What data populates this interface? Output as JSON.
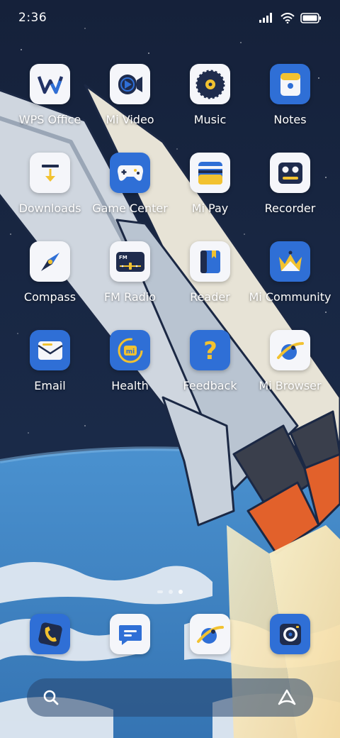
{
  "status": {
    "time": "2:36",
    "icons": [
      "signal-icon",
      "wifi-icon",
      "battery-icon"
    ]
  },
  "apps": [
    {
      "label": "WPS Office",
      "icon": "wps-office-icon"
    },
    {
      "label": "Mi Video",
      "icon": "mi-video-icon"
    },
    {
      "label": "Music",
      "icon": "music-icon"
    },
    {
      "label": "Notes",
      "icon": "notes-icon"
    },
    {
      "label": "Downloads",
      "icon": "downloads-icon"
    },
    {
      "label": "Game Center",
      "icon": "game-center-icon"
    },
    {
      "label": "Mi Pay",
      "icon": "mi-pay-icon"
    },
    {
      "label": "Recorder",
      "icon": "recorder-icon"
    },
    {
      "label": "Compass",
      "icon": "compass-icon"
    },
    {
      "label": "FM Radio",
      "icon": "fm-radio-icon"
    },
    {
      "label": "Reader",
      "icon": "reader-icon"
    },
    {
      "label": "Mi Community",
      "icon": "mi-community-icon"
    },
    {
      "label": "Email",
      "icon": "email-icon"
    },
    {
      "label": "Health",
      "icon": "health-icon"
    },
    {
      "label": "Feedback",
      "icon": "feedback-icon"
    },
    {
      "label": "Mi Browser",
      "icon": "mi-browser-icon"
    }
  ],
  "icon_text": {
    "fm": "FM",
    "health": "mi",
    "feedback": "?"
  },
  "pages": {
    "count": 3,
    "current": 2
  },
  "dock": [
    {
      "icon": "phone-icon"
    },
    {
      "icon": "messages-icon"
    },
    {
      "icon": "browser-icon"
    },
    {
      "icon": "camera-icon"
    }
  ],
  "search_bar": {
    "left_icon": "search-icon",
    "right_icon": "assistant-icon"
  },
  "colors": {
    "accent_blue": "#2f6fd6",
    "accent_yellow": "#f2c230",
    "sky": "#14203a",
    "earth": "#3f83c4"
  }
}
